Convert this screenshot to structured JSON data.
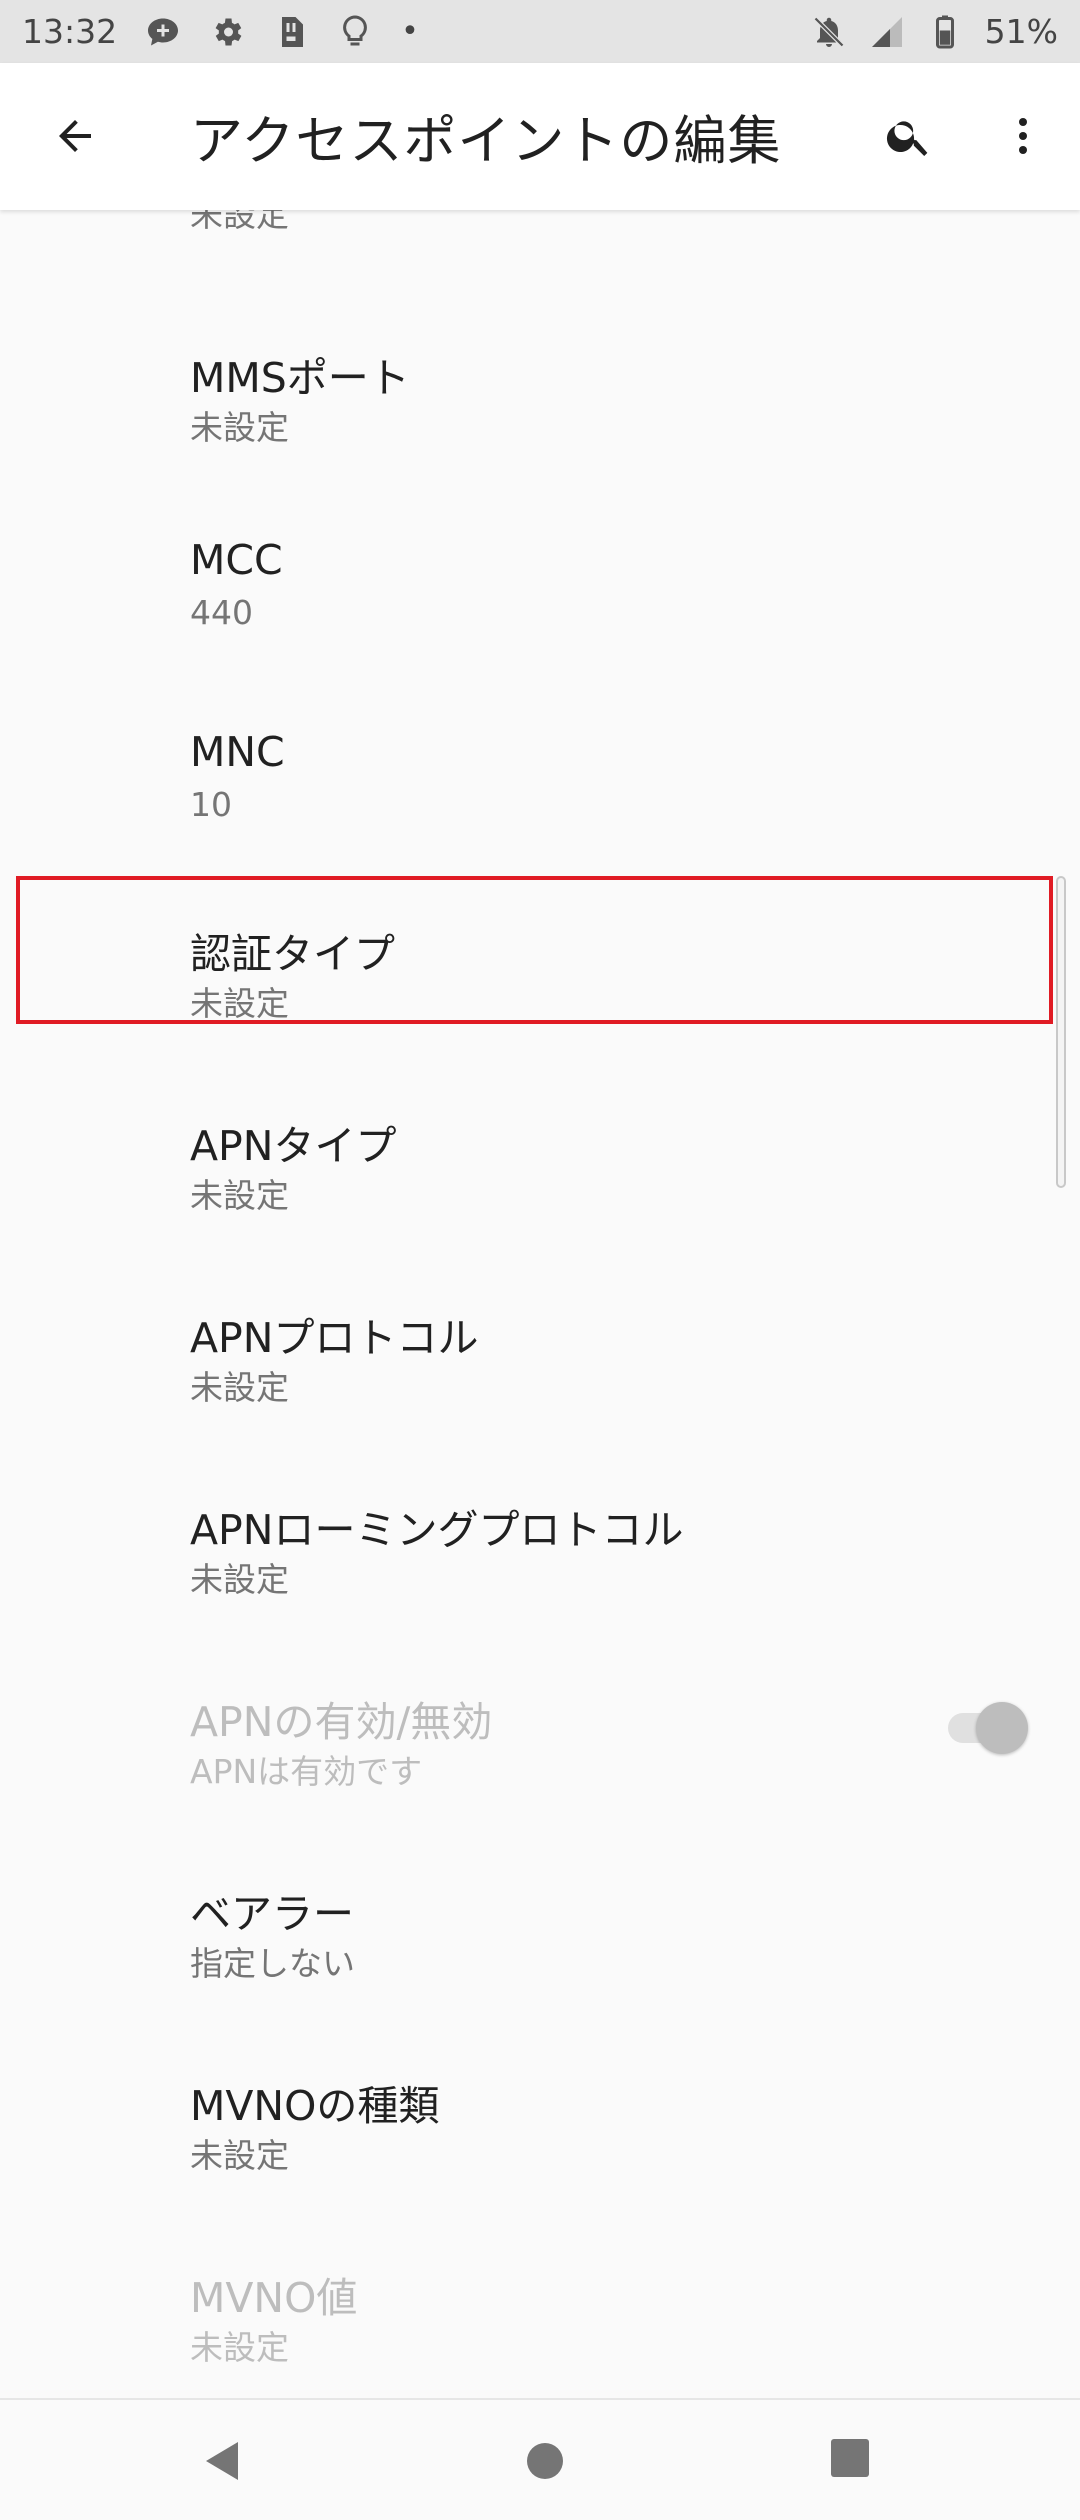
{
  "status_bar": {
    "time": "13:32",
    "battery": "51%",
    "icons": [
      "chat-plus-icon",
      "gear-icon",
      "sim-icon",
      "bulb-icon",
      "dot-icon",
      "mute-icon",
      "signal-icon",
      "battery-icon"
    ]
  },
  "app_bar": {
    "title": "アクセスポイントの編集",
    "back_icon": "arrow-back-icon",
    "search_icon": "search-icon",
    "more_icon": "more-vert-icon"
  },
  "list": {
    "partial_summary": "未設定",
    "items": [
      {
        "title": "MMSポート",
        "summary": "未設定",
        "enabled": true
      },
      {
        "title": "MCC",
        "summary": "440",
        "enabled": true
      },
      {
        "title": "MNC",
        "summary": "10",
        "enabled": true
      },
      {
        "title": "認証タイプ",
        "summary": "未設定",
        "enabled": true,
        "highlighted": true
      },
      {
        "title": "APNタイプ",
        "summary": "未設定",
        "enabled": true
      },
      {
        "title": "APNプロトコル",
        "summary": "未設定",
        "enabled": true
      },
      {
        "title": "APNローミングプロトコル",
        "summary": "未設定",
        "enabled": true
      },
      {
        "title": "APNの有効/無効",
        "summary": "APNは有効です",
        "enabled": false,
        "toggle": {
          "checked": true
        }
      },
      {
        "title": "ベアラー",
        "summary": "指定しない",
        "enabled": true
      },
      {
        "title": "MVNOの種類",
        "summary": "未設定",
        "enabled": true
      },
      {
        "title": "MVNO値",
        "summary": "未設定",
        "enabled": false
      }
    ]
  },
  "colors": {
    "highlight": "#e01b24",
    "status_bar_bg": "#e4e4e4",
    "text_primary": "#212121",
    "text_secondary": "#757575",
    "text_disabled": "#bdbdbd"
  },
  "nav_bar": {
    "back_icon": "nav-back-triangle-icon",
    "home_icon": "nav-home-circle-icon",
    "recents_icon": "nav-recents-square-icon"
  }
}
